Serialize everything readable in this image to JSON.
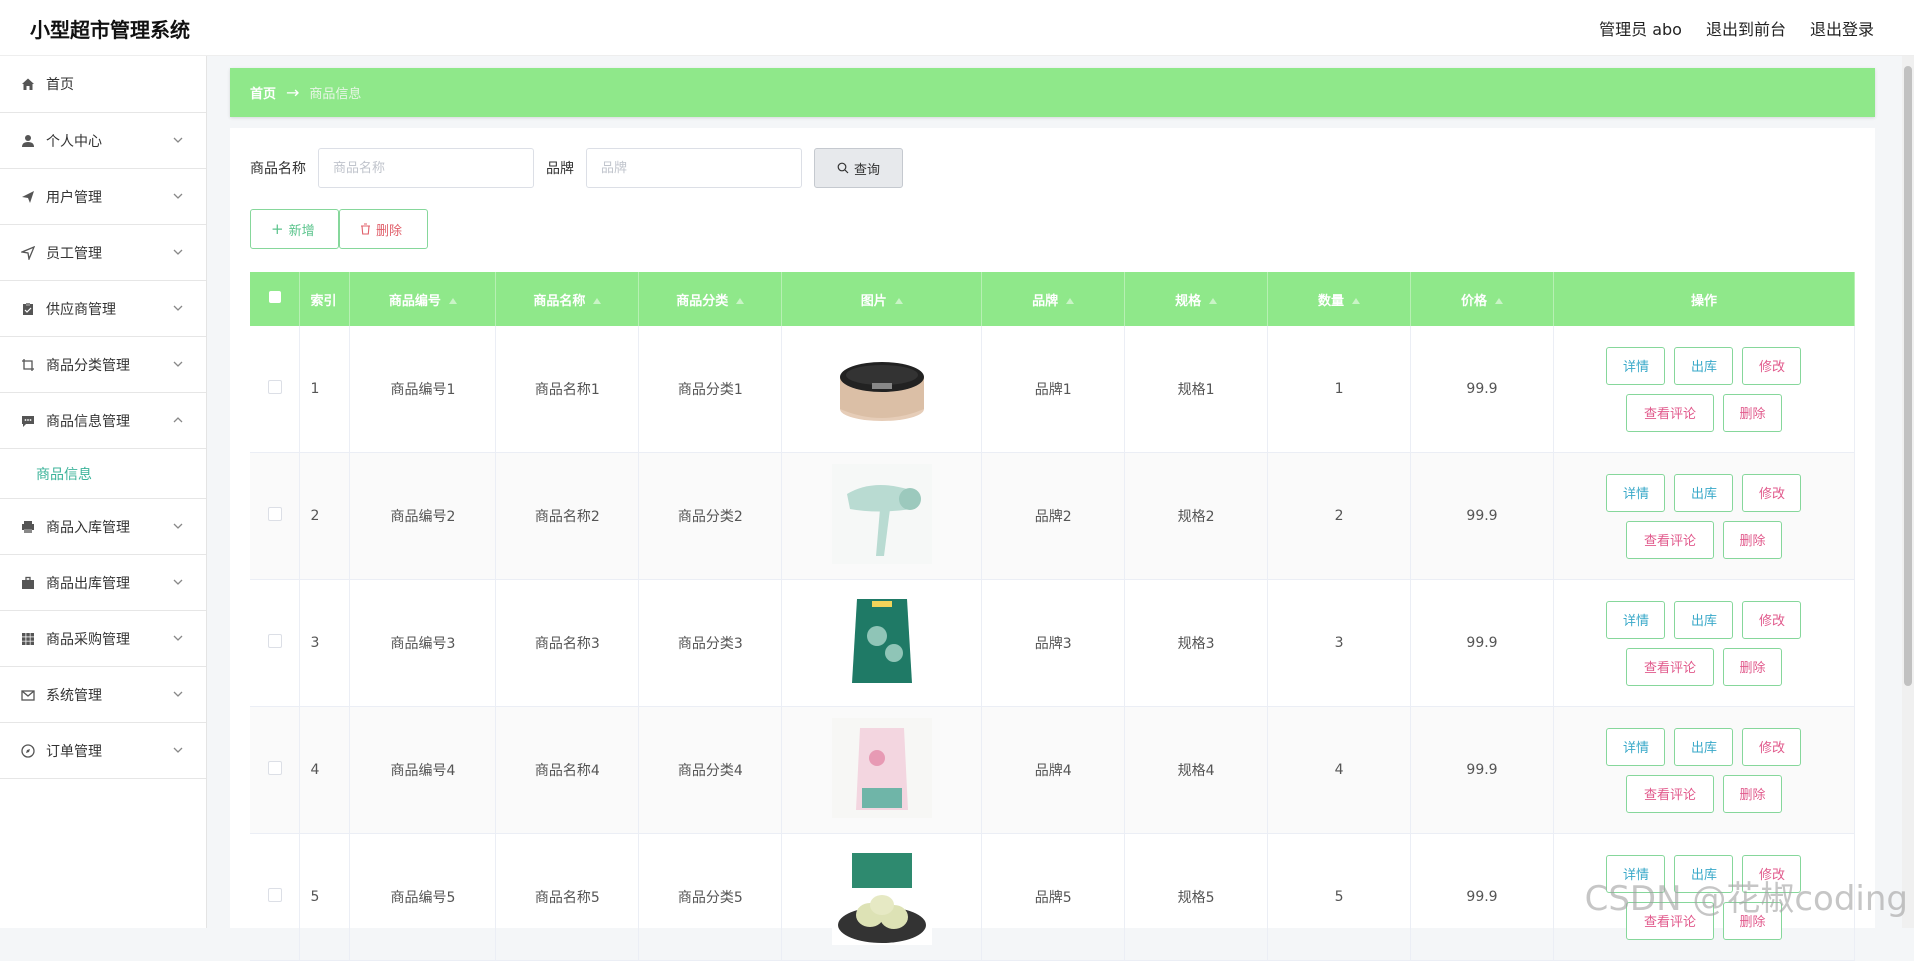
{
  "app": {
    "title": "小型超市管理系统"
  },
  "header": {
    "user_label": "管理员 abo",
    "front_label": "退出到前台",
    "logout_label": "退出登录"
  },
  "sidebar": {
    "items": [
      {
        "label": "首页",
        "icon": "home-icon"
      },
      {
        "label": "个人中心",
        "icon": "user-icon"
      },
      {
        "label": "用户管理",
        "icon": "send-icon"
      },
      {
        "label": "员工管理",
        "icon": "location-icon"
      },
      {
        "label": "供应商管理",
        "icon": "clipboard-icon"
      },
      {
        "label": "商品分类管理",
        "icon": "crop-icon"
      },
      {
        "label": "商品信息管理",
        "icon": "chat-icon"
      },
      {
        "label": "商品入库管理",
        "icon": "printer-icon"
      },
      {
        "label": "商品出库管理",
        "icon": "briefcase-icon"
      },
      {
        "label": "商品采购管理",
        "icon": "grid-icon"
      },
      {
        "label": "系统管理",
        "icon": "mail-icon"
      },
      {
        "label": "订单管理",
        "icon": "compass-icon"
      }
    ],
    "active_sub": "商品信息"
  },
  "breadcrumb": {
    "home": "首页",
    "arrow": "→",
    "current": "商品信息"
  },
  "search": {
    "name_label": "商品名称",
    "name_placeholder": "商品名称",
    "brand_label": "品牌",
    "brand_placeholder": "品牌",
    "query_label": "查询"
  },
  "actions": {
    "add_label": "新增",
    "delete_label": "删除"
  },
  "table": {
    "headers": [
      "索引",
      "商品编号",
      "商品名称",
      "商品分类",
      "图片",
      "品牌",
      "规格",
      "数量",
      "价格",
      "操作"
    ],
    "rows": [
      {
        "idx": "1",
        "code": "商品编号1",
        "name": "商品名称1",
        "category": "商品分类1",
        "image": "rice-cooker",
        "brand": "品牌1",
        "spec": "规格1",
        "qty": "1",
        "price": "99.9"
      },
      {
        "idx": "2",
        "code": "商品编号2",
        "name": "商品名称2",
        "category": "商品分类2",
        "image": "hair-dryer",
        "brand": "品牌2",
        "spec": "规格2",
        "qty": "2",
        "price": "99.9"
      },
      {
        "idx": "3",
        "code": "商品编号3",
        "name": "商品名称3",
        "category": "商品分类3",
        "image": "rice-bag-green",
        "brand": "品牌3",
        "spec": "规格3",
        "qty": "3",
        "price": "99.9"
      },
      {
        "idx": "4",
        "code": "商品编号4",
        "name": "商品名称4",
        "category": "商品分类4",
        "image": "rice-bag-pink",
        "brand": "品牌4",
        "spec": "规格4",
        "qty": "4",
        "price": "99.9"
      },
      {
        "idx": "5",
        "code": "商品编号5",
        "name": "商品名称5",
        "category": "商品分类5",
        "image": "mooncakes",
        "brand": "品牌5",
        "spec": "规格5",
        "qty": "5",
        "price": "99.9"
      }
    ],
    "ops": {
      "detail": "详情",
      "out": "出库",
      "edit": "修改",
      "review": "查看评论",
      "delete": "删除"
    }
  },
  "watermark": "CSDN @花椒coding",
  "colors": {
    "accent": "#8fe88a",
    "teal": "#3aa9c9",
    "pink": "#e15a8c"
  }
}
